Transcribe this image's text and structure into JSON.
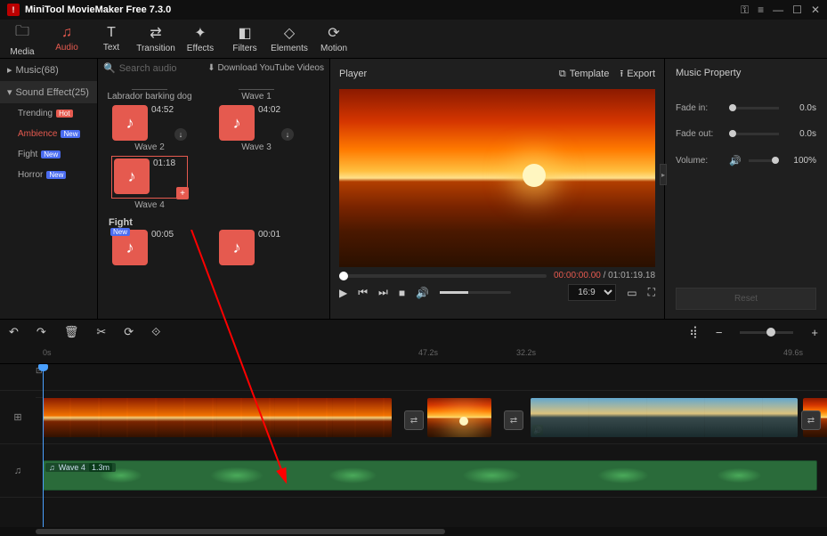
{
  "app": {
    "title": "MiniTool MovieMaker Free 7.3.0"
  },
  "ribbon": [
    {
      "label": "Media",
      "icon": "🗀"
    },
    {
      "label": "Audio",
      "icon": "♫"
    },
    {
      "label": "Text",
      "icon": "T"
    },
    {
      "label": "Transition",
      "icon": "⇄"
    },
    {
      "label": "Effects",
      "icon": "✦"
    },
    {
      "label": "Filters",
      "icon": "◧"
    },
    {
      "label": "Elements",
      "icon": "◇"
    },
    {
      "label": "Motion",
      "icon": "⟳"
    }
  ],
  "sidebar": {
    "music": "Music(68)",
    "sound": "Sound Effect(25)",
    "subs": [
      {
        "label": "Trending",
        "badge": "Hot",
        "cls": "hot"
      },
      {
        "label": "Ambience",
        "badge": "New",
        "cls": "new"
      },
      {
        "label": "Fight",
        "badge": "New",
        "cls": "new"
      },
      {
        "label": "Horror",
        "badge": "New",
        "cls": "new"
      }
    ]
  },
  "assets": {
    "search": "Search audio",
    "download": "Download YouTube Videos",
    "row0": [
      {
        "caption": "Labrador barking dog"
      },
      {
        "caption": "Wave 1"
      }
    ],
    "row1": [
      {
        "caption": "Wave 2",
        "dur": "04:52"
      },
      {
        "caption": "Wave 3",
        "dur": "04:02"
      }
    ],
    "row2": [
      {
        "caption": "Wave 4",
        "dur": "01:18"
      }
    ],
    "group2": "Fight",
    "row3": [
      {
        "dur": "00:05"
      },
      {
        "dur": "00:01"
      }
    ]
  },
  "player": {
    "label": "Player",
    "template": "Template",
    "export": "Export",
    "cur": "00:00:00.00",
    "total": "01:01:19.18",
    "ratio": "16:9"
  },
  "props": {
    "header": "Music Property",
    "fadein": {
      "label": "Fade in:",
      "val": "0.0s"
    },
    "fadeout": {
      "label": "Fade out:",
      "val": "0.0s"
    },
    "volume": {
      "label": "Volume:",
      "val": "100%"
    },
    "reset": "Reset"
  },
  "ruler": {
    "t0": "0s",
    "t1": "47.2s",
    "t2": "32.2s",
    "t3": "49.6s"
  },
  "aclip": {
    "name": "Wave 4",
    "len": "1.3m"
  }
}
